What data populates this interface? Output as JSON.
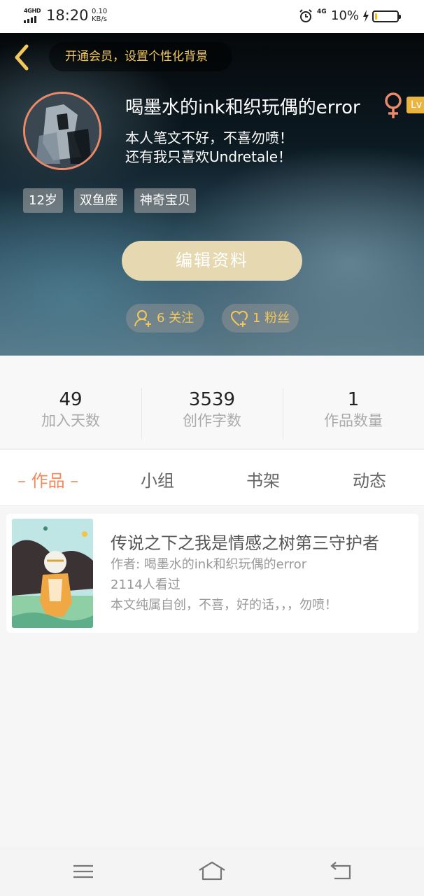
{
  "status_bar": {
    "network": "4GHD",
    "time": "18:20",
    "speed_value": "0.10",
    "speed_unit": "KB/s",
    "sim_label": "4G",
    "battery_pct": "10%",
    "battery_level": 0.1,
    "battery_color": "#f3c20c"
  },
  "header": {
    "vip_prompt": "开通会员，设置个性化背景",
    "user_name": "喝墨水的ink和织玩偶的error",
    "level_label": "Lv",
    "bio_line1": "本人笔文不好，不喜勿喷！",
    "bio_line2": "还有我只喜欢Undretale！",
    "tags": [
      "12岁",
      "双鱼座",
      "神奇宝贝"
    ],
    "edit_button": "编辑资料",
    "following_label": "6 关注",
    "fans_label": "1 粉丝",
    "accent_color": "#f3c85a"
  },
  "stats": [
    {
      "value": "49",
      "label": "加入天数"
    },
    {
      "value": "3539",
      "label": "创作字数"
    },
    {
      "value": "1",
      "label": "作品数量"
    }
  ],
  "tabs": [
    {
      "label": "– 作品 –",
      "active": true
    },
    {
      "label": "小组",
      "active": false
    },
    {
      "label": "书架",
      "active": false
    },
    {
      "label": "动态",
      "active": false
    }
  ],
  "book": {
    "title": "传说之下之我是情感之树第三守护者",
    "author": "作者: 喝墨水的ink和织玩偶的error",
    "views": "2114人看过",
    "description": "本文纯属自创，不喜，好的话，，，勿喷！"
  },
  "nav": {
    "icons": [
      "menu-icon",
      "home-icon",
      "back-icon"
    ]
  }
}
